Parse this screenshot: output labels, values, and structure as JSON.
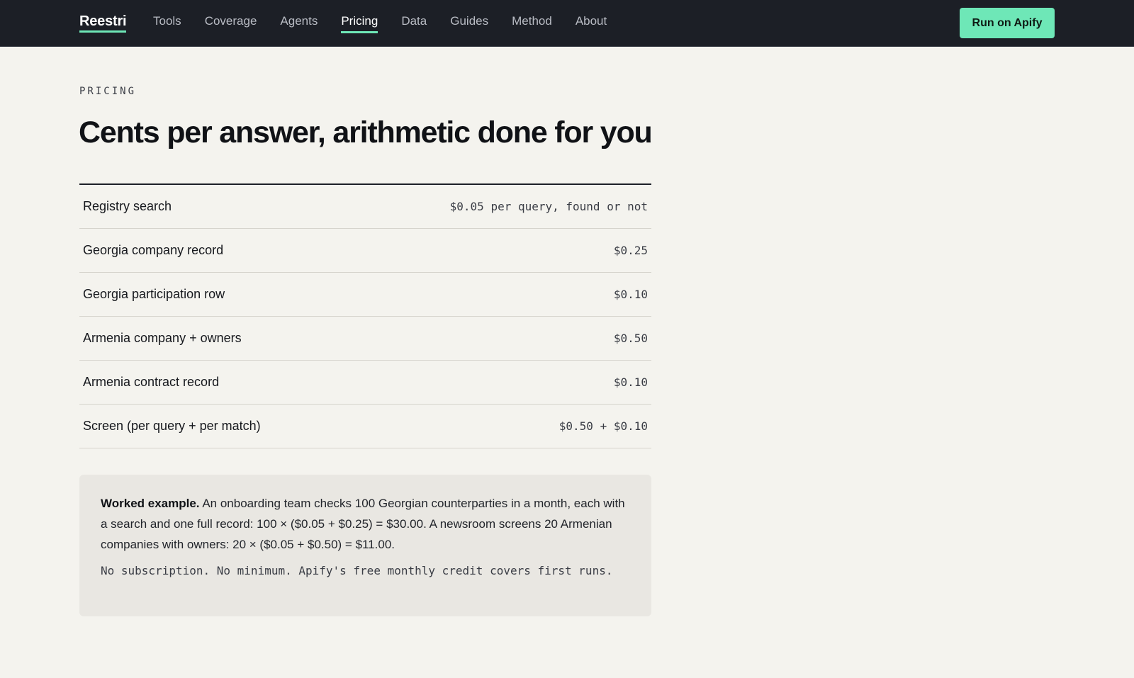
{
  "header": {
    "brand": "Reestri",
    "nav": [
      {
        "label": "Tools",
        "active": false
      },
      {
        "label": "Coverage",
        "active": false
      },
      {
        "label": "Agents",
        "active": false
      },
      {
        "label": "Pricing",
        "active": true
      },
      {
        "label": "Data",
        "active": false
      },
      {
        "label": "Guides",
        "active": false
      },
      {
        "label": "Method",
        "active": false
      },
      {
        "label": "About",
        "active": false
      }
    ],
    "cta_label": "Run on Apify"
  },
  "main": {
    "eyebrow": "PRICING",
    "title": "Cents per answer, arithmetic done for you",
    "price_rows": [
      {
        "label": "Registry search",
        "value": "$0.05 per query, found or not"
      },
      {
        "label": "Georgia company record",
        "value": "$0.25"
      },
      {
        "label": "Georgia participation row",
        "value": "$0.10"
      },
      {
        "label": "Armenia company + owners",
        "value": "$0.50"
      },
      {
        "label": "Armenia contract record",
        "value": "$0.10"
      },
      {
        "label": "Screen (per query + per match)",
        "value": "$0.50 + $0.10"
      }
    ],
    "example": {
      "lead": "Worked example.",
      "text": " An onboarding team checks 100 Georgian counterparties in a month, each with a search and one full record: 100 × ($0.05 + $0.25) = $30.00. A newsroom screens 20 Armenian companies with owners: 20 × ($0.05 + $0.50) = $11.00.",
      "note": "No subscription. No minimum. Apify's free monthly credit covers first runs."
    }
  },
  "colors": {
    "topbar_bg": "#1c1f26",
    "accent": "#6ee7b7",
    "page_bg": "#f4f3ee",
    "card_bg": "#e9e7e2"
  }
}
